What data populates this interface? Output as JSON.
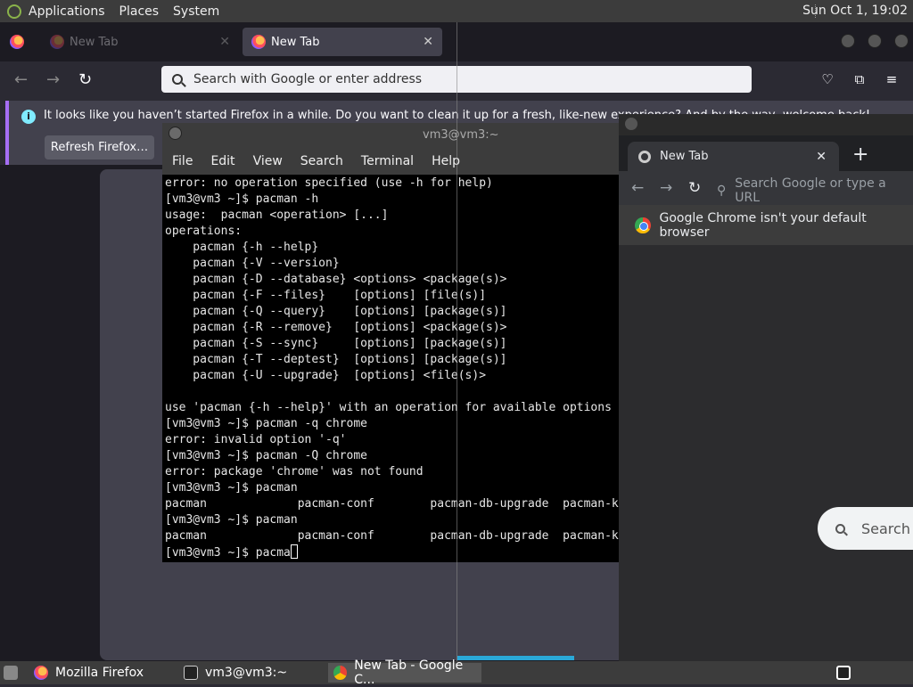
{
  "panel": {
    "menus": [
      "Applications",
      "Places",
      "System"
    ],
    "clock": "Sun Oct 1, 19:02"
  },
  "firefox": {
    "tabs": [
      {
        "label": "New Tab"
      },
      {
        "label": "New Tab"
      }
    ],
    "urlbar_placeholder": "Search with Google or enter address",
    "notice": {
      "message": "It looks like you haven’t started Firefox in a while. Do you want to clean it up for a fresh, like-new experience? And by the way, welcome back!",
      "button": "Refresh Firefox…"
    }
  },
  "terminal": {
    "title": "vm3@vm3:~",
    "menu": [
      "File",
      "Edit",
      "View",
      "Search",
      "Terminal",
      "Help"
    ],
    "lines": [
      "error: no operation specified (use -h for help)",
      "[vm3@vm3 ~]$ pacman -h",
      "usage:  pacman <operation> [...]",
      "operations:",
      "    pacman {-h --help}",
      "    pacman {-V --version}",
      "    pacman {-D --database} <options> <package(s)>",
      "    pacman {-F --files}    [options] [file(s)]",
      "    pacman {-Q --query}    [options] [package(s)]",
      "    pacman {-R --remove}   [options] <package(s)>",
      "    pacman {-S --sync}     [options] [package(s)]",
      "    pacman {-T --deptest}  [options] [package(s)]",
      "    pacman {-U --upgrade}  [options] <file(s)>",
      "",
      "use 'pacman {-h --help}' with an operation for available options",
      "[vm3@vm3 ~]$ pacman -q chrome",
      "error: invalid option '-q'",
      "[vm3@vm3 ~]$ pacman -Q chrome",
      "error: package 'chrome' was not found",
      "[vm3@vm3 ~]$ pacman",
      "pacman             pacman-conf        pacman-db-upgrade  pacman-key",
      "[vm3@vm3 ~]$ pacman",
      "pacman             pacman-conf        pacman-db-upgrade  pacman-key"
    ],
    "prompt_line": "[vm3@vm3 ~]$ pacma"
  },
  "chrome": {
    "tab_label": "New Tab",
    "omnibox_placeholder": "Search Google or type a URL",
    "info_bar": "Google Chrome isn't your default browser",
    "search_box": "Search"
  },
  "taskbar": {
    "items": [
      {
        "label": "Mozilla Firefox"
      },
      {
        "label": "vm3@vm3:~"
      },
      {
        "label": "New Tab - Google C..."
      }
    ]
  }
}
